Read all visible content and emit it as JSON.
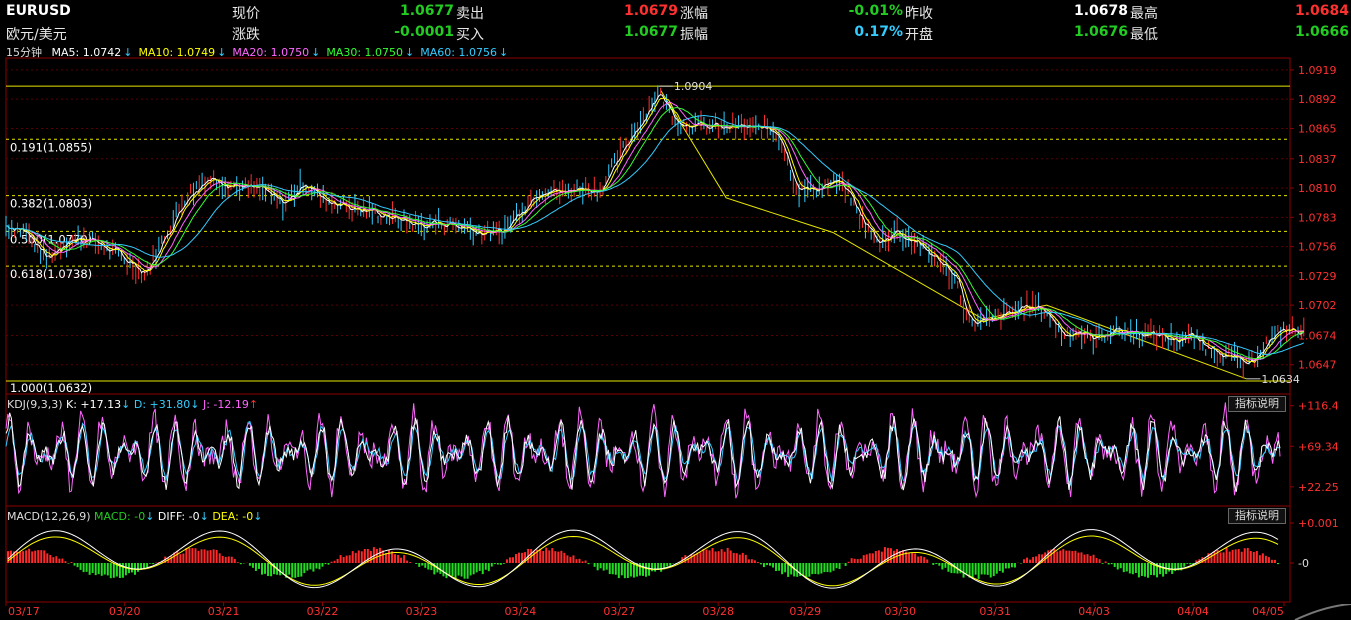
{
  "quote": {
    "symbol": "EURUSD",
    "name": "欧元/美元",
    "rows": [
      [
        {
          "label": "现价",
          "value": "1.0677",
          "color": "#22cc22"
        },
        {
          "label": "卖出",
          "value": "1.0679",
          "color": "#ff3030"
        },
        {
          "label": "涨幅",
          "value": "-0.01%",
          "color": "#22cc22"
        },
        {
          "label": "昨收",
          "value": "1.0678",
          "color": "#ffffff"
        },
        {
          "label": "最高",
          "value": "1.0684",
          "color": "#ff3030"
        }
      ],
      [
        {
          "label": "涨跌",
          "value": "-0.0001",
          "color": "#22cc22"
        },
        {
          "label": "买入",
          "value": "1.0677",
          "color": "#22cc22"
        },
        {
          "label": "振幅",
          "value": "0.17%",
          "color": "#33ccff"
        },
        {
          "label": "开盘",
          "value": "1.0676",
          "color": "#22cc22"
        },
        {
          "label": "最低",
          "value": "1.0666",
          "color": "#22cc22"
        }
      ]
    ]
  },
  "main_panel": {
    "period": "15分钟",
    "ma": [
      {
        "text": "MA5: 1.0742",
        "color": "#ffffff"
      },
      {
        "text": "MA10: 1.0749",
        "color": "#ffff00"
      },
      {
        "text": "MA20: 1.0750",
        "color": "#ff66ff"
      },
      {
        "text": "MA30: 1.0750",
        "color": "#33ff33"
      },
      {
        "text": "MA60: 1.0756",
        "color": "#33ccff"
      }
    ],
    "ylim": [
      1.062,
      1.093
    ],
    "y_ticks": [
      "1.0919",
      "1.0892",
      "1.0865",
      "1.0837",
      "1.0810",
      "1.0783",
      "1.0756",
      "1.0729",
      "1.0702",
      "1.0674",
      "1.0647"
    ],
    "y_tick_values": [
      1.0919,
      1.0892,
      1.0865,
      1.0837,
      1.081,
      1.0783,
      1.0756,
      1.0729,
      1.0702,
      1.0674,
      1.0647
    ],
    "fib_levels": [
      {
        "label": "0.191(1.0855)",
        "value": 1.0855
      },
      {
        "label": "0.382(1.0803)",
        "value": 1.0803
      },
      {
        "label": "0.500(1.0770)",
        "value": 1.077
      },
      {
        "label": "0.618(1.0738)",
        "value": 1.0738
      }
    ],
    "fib_bounds": [
      {
        "label": "",
        "value": 1.0904
      },
      {
        "label": "1.000(1.0632)",
        "value": 1.0632
      }
    ],
    "high_marker": {
      "label": "1.0904",
      "x": 16.5,
      "value": 1.0904
    },
    "low_marker": {
      "label": "1.0634",
      "x": 31.35,
      "value": 1.0634
    },
    "trendline_points": [
      [
        16.55,
        1.09
      ],
      [
        18.2,
        1.0801
      ],
      [
        20.9,
        1.0769
      ],
      [
        24.7,
        1.0689
      ],
      [
        26.3,
        1.0702
      ],
      [
        31.35,
        1.0634
      ]
    ]
  },
  "chart_data": {
    "type": "line",
    "x_labels": [
      "03/17",
      "03/20",
      "03/21",
      "03/22",
      "03/23",
      "03/24",
      "03/27",
      "03/28",
      "03/29",
      "03/30",
      "03/31",
      "04/03",
      "04/04",
      "04/05"
    ],
    "x_label_pos": [
      0,
      3,
      5.5,
      8,
      10.5,
      13,
      15.5,
      18,
      20.2,
      22.6,
      25,
      27.5,
      30,
      32.3
    ],
    "price_series": {
      "name": "EURUSD",
      "x": [
        0,
        0.5,
        1,
        1.5,
        2,
        2.5,
        3,
        3.5,
        4,
        4.5,
        5,
        5.5,
        6,
        6.5,
        7,
        7.5,
        8,
        8.5,
        9,
        9.5,
        10,
        10.5,
        11,
        11.5,
        12,
        12.5,
        13,
        13.5,
        14,
        14.5,
        15,
        15.5,
        16,
        16.2,
        16.5,
        16.8,
        17,
        17.5,
        18,
        18.5,
        19,
        19.2,
        19.5,
        20,
        20.5,
        21,
        21.3,
        21.5,
        22,
        22.5,
        23,
        23.5,
        24,
        24.3,
        24.6,
        25,
        25.5,
        26,
        26.3,
        26.7,
        27,
        27.5,
        28,
        28.5,
        29,
        29.5,
        30,
        30.5,
        31,
        31.35,
        31.8,
        32.3,
        32.8
      ],
      "y": [
        1.0775,
        1.077,
        1.0745,
        1.076,
        1.0765,
        1.0755,
        1.0745,
        1.073,
        1.0765,
        1.08,
        1.0818,
        1.0815,
        1.081,
        1.0808,
        1.0795,
        1.0815,
        1.08,
        1.0795,
        1.079,
        1.0785,
        1.078,
        1.0775,
        1.0778,
        1.0775,
        1.077,
        1.0768,
        1.079,
        1.0808,
        1.0806,
        1.081,
        1.0808,
        1.084,
        1.087,
        1.0882,
        1.0898,
        1.088,
        1.087,
        1.0868,
        1.0866,
        1.0867,
        1.0864,
        1.0866,
        1.0862,
        1.0808,
        1.081,
        1.0815,
        1.0805,
        1.0788,
        1.076,
        1.077,
        1.076,
        1.0745,
        1.0725,
        1.069,
        1.0686,
        1.069,
        1.0697,
        1.0702,
        1.0695,
        1.0675,
        1.0678,
        1.067,
        1.068,
        1.0676,
        1.0675,
        1.067,
        1.0672,
        1.066,
        1.0655,
        1.0645,
        1.0665,
        1.068,
        1.0677
      ]
    },
    "kdj": {
      "label": "KDJ(9,3,3)",
      "values": [
        {
          "text": "K: +17.13",
          "color": "#ffffff",
          "arrow": "↓"
        },
        {
          "text": "D: +31.80",
          "color": "#33ccff",
          "arrow": "↓"
        },
        {
          "text": "J: -12.19",
          "color": "#ff66ff",
          "arrow": "↑"
        }
      ],
      "ylim": [
        0,
        130
      ],
      "y_ticks": [
        "+116.4",
        "+69.34",
        "+22.25"
      ],
      "y_tick_values": [
        116.4,
        69.34,
        22.25
      ]
    },
    "macd": {
      "label": "MACD(12,26,9)",
      "values": [
        {
          "text": "MACD: -0",
          "color": "#22cc22",
          "arrow": "↓"
        },
        {
          "text": "DIFF: -0",
          "color": "#ffffff",
          "arrow": "↓"
        },
        {
          "text": "DEA: -0",
          "color": "#ffff00",
          "arrow": "↓"
        }
      ],
      "y_ticks": [
        "+0.001",
        "-0"
      ],
      "y_tick_values": [
        0.001,
        0
      ]
    }
  },
  "ui": {
    "hint_button": "指标说明"
  }
}
